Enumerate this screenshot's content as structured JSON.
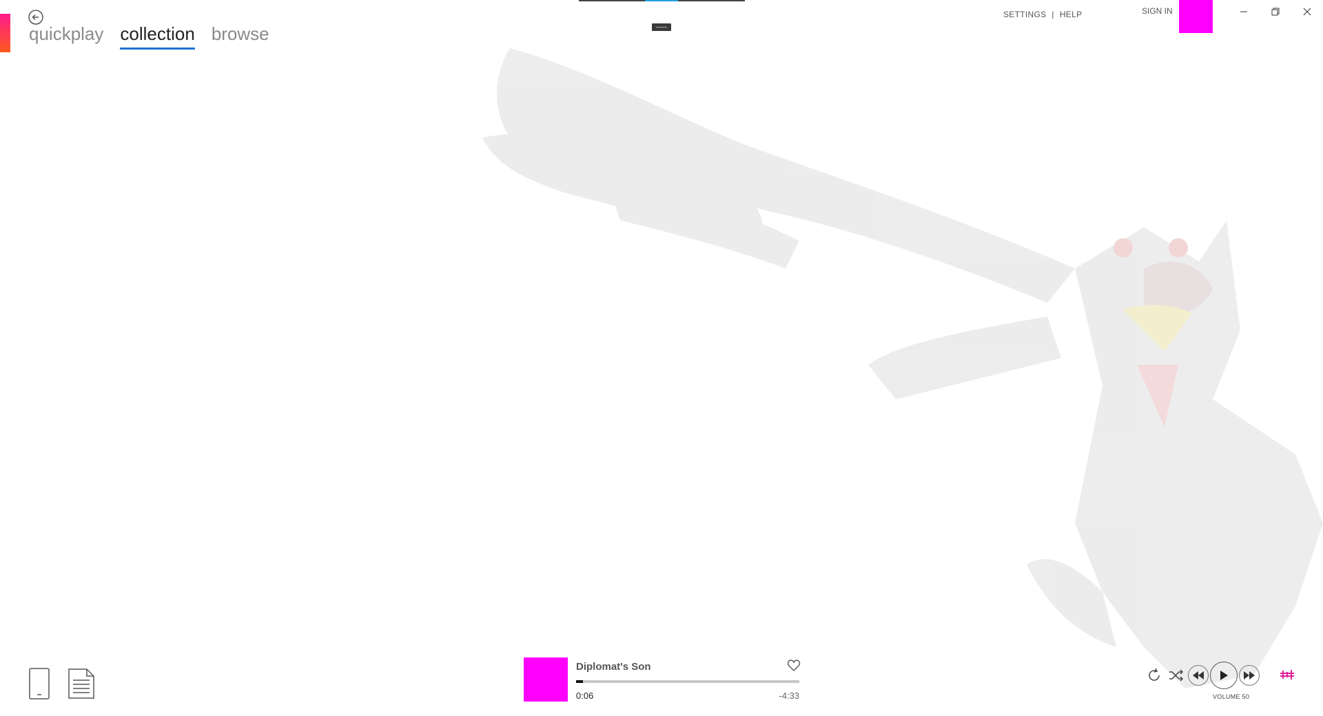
{
  "nav": {
    "tabs": [
      {
        "label": "quickplay",
        "active": false
      },
      {
        "label": "collection",
        "active": true
      },
      {
        "label": "browse",
        "active": false
      }
    ]
  },
  "header": {
    "settings_label": "SETTINGS",
    "separator": "|",
    "help_label": "HELP",
    "sign_in_label": "SIGN IN"
  },
  "player": {
    "track_title": "Diplomat's Son",
    "time_elapsed": "0:06",
    "time_remaining": "-4:33",
    "progress": 0.03,
    "volume_label": "VOLUME 50"
  },
  "colors": {
    "accent": "#1f6fd1",
    "album_placeholder": "#ff00ff",
    "brand_gradient_top": "#ff1a8c",
    "brand_gradient_bottom": "#ff5a1f",
    "eq_accent": "#e0209a"
  },
  "icons": {
    "back": "back-arrow-icon",
    "device": "phone-icon",
    "playlist": "document-icon",
    "favorite": "heart-icon",
    "repeat": "repeat-icon",
    "shuffle": "shuffle-icon",
    "previous": "rewind-icon",
    "play": "play-icon",
    "next": "fast-forward-icon",
    "equalizer": "equalizer-icon"
  }
}
